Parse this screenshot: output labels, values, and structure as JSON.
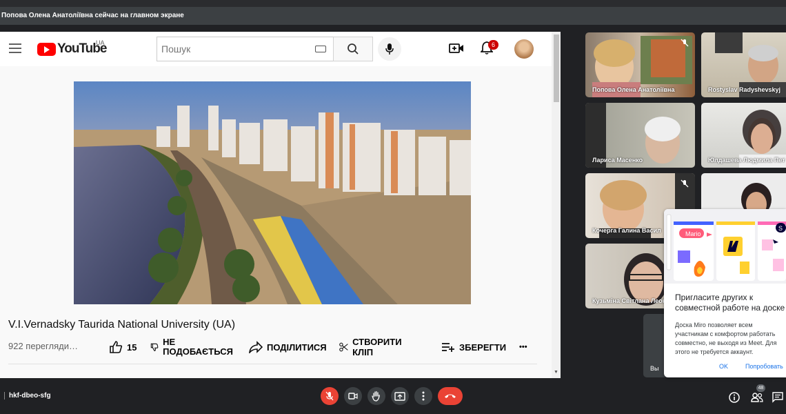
{
  "presenting": {
    "text": "Попова Олена Анатоліївна сейчас на главном экране"
  },
  "youtube": {
    "logo_text": "YouTube",
    "country": "UA",
    "search_placeholder": "Пошук",
    "notifications": "6",
    "video_title": "V.I.Vernadsky Taurida National University (UA)",
    "views": "922 перегляди…",
    "actions": {
      "like_count": "15",
      "dislike": "НЕ ПОДОБАЄТЬСЯ",
      "share": "ПОДІЛИТИСЯ",
      "clip": "СТВОРИТИ КЛІП",
      "save": "ЗБЕРЕГТИ",
      "more": "•••"
    }
  },
  "participants": [
    {
      "name": "Попова Олена Анатоліївна"
    },
    {
      "name": "Rostyslav Radyshevskyj"
    },
    {
      "name": "Лариса Масенко"
    },
    {
      "name": "Юлдашева Людмила Пет"
    },
    {
      "name": "Кочерга Галина Васил"
    },
    {
      "name": ""
    },
    {
      "name": "Кузьміна Світлана Леон"
    }
  ],
  "self_tile": {
    "label": "Вы"
  },
  "miro": {
    "title": "Пригласите других к совместной работе на доске",
    "body": "Доска Miro позволяет всем участникам с комфортом работать совместно, не выходя из Meet. Для этого не требуется аккаунт.",
    "ok": "OK",
    "try": "Попробовать",
    "mario_tag": "Mario",
    "s_tag": "S"
  },
  "bottom": {
    "meeting_code": "hkf-dbeo-sfg",
    "people_count": "48"
  }
}
